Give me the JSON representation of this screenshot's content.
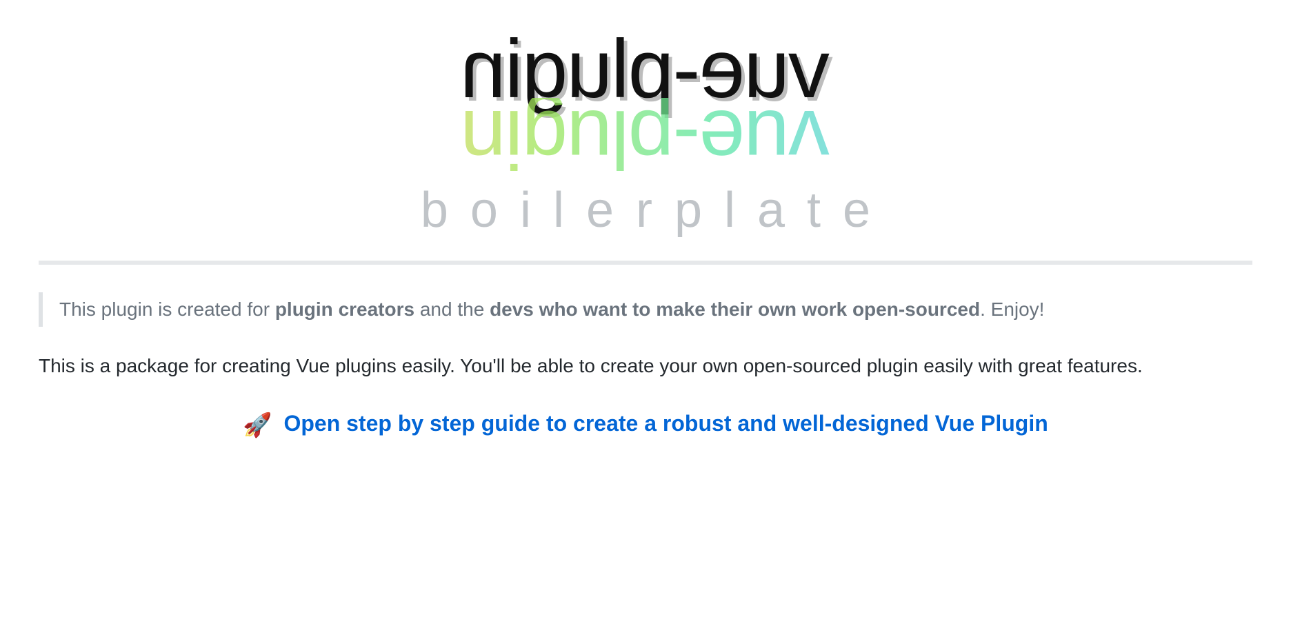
{
  "logo": {
    "line1": "vue-plugin",
    "line2": "vue-plugin",
    "line3": "boilerplate"
  },
  "blockquote": {
    "pre": "This plugin is created for ",
    "strong1": "plugin creators",
    "mid": " and the ",
    "strong2": "devs who want to make their own work open-sourced",
    "post": ". Enjoy!"
  },
  "body": "This is a package for creating Vue plugins easily. You'll be able to create your own open-sourced plugin easily with great features.",
  "guide": {
    "emoji": "🚀",
    "link_text": "Open step by step guide to create a robust and well-designed Vue Plugin"
  }
}
